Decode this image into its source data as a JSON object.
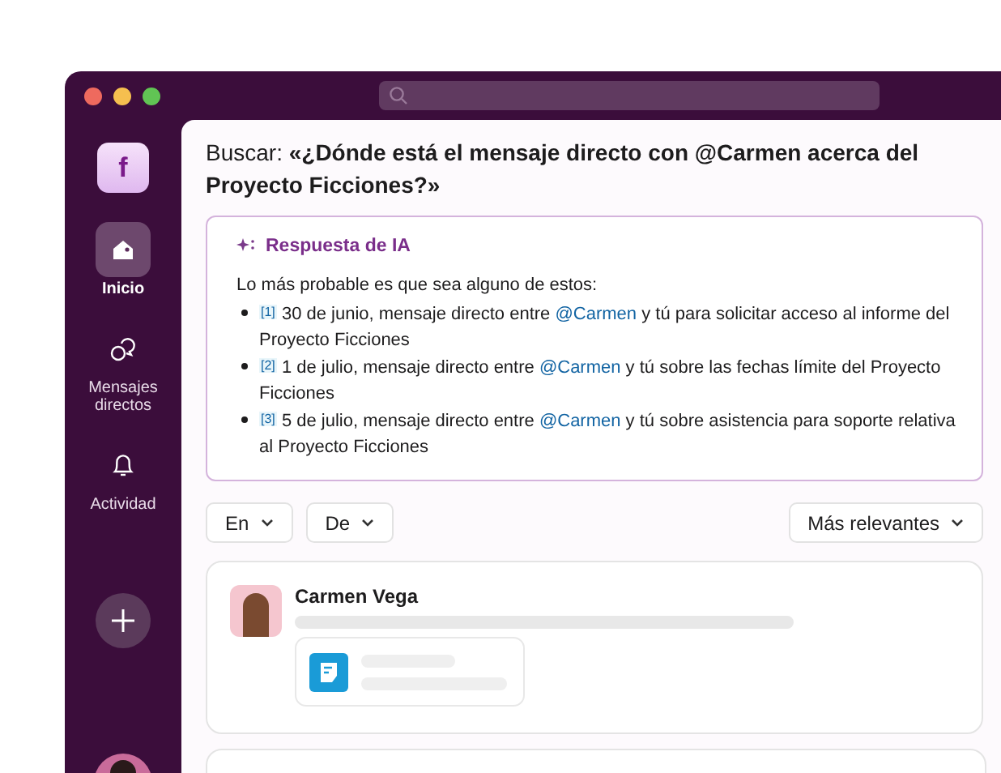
{
  "sidebar": {
    "workspace": "f",
    "items": [
      {
        "kind": "home",
        "label": "Inicio",
        "selected": true
      },
      {
        "kind": "dms",
        "label": "Mensajes directos",
        "selected": false
      },
      {
        "kind": "activity",
        "label": "Actividad",
        "selected": false
      }
    ]
  },
  "search": {
    "prefix": "Buscar:",
    "query": "«¿Dónde está el mensaje directo con @Carmen acerca del Proyecto Ficciones?»"
  },
  "ai_answer": {
    "title": "Respuesta de IA",
    "intro": "Lo más probable es que sea alguno de estos:",
    "items": [
      {
        "cite": "[1]",
        "before": "30 de junio, mensaje directo entre",
        "mention": "@Carmen",
        "after": "y tú para solicitar acceso al informe del Proyecto Ficciones"
      },
      {
        "cite": "[2]",
        "before": "1 de julio, mensaje directo entre",
        "mention": "@Carmen",
        "after": "y tú sobre las fechas límite del Proyecto Ficciones"
      },
      {
        "cite": "[3]",
        "before": "5 de julio, mensaje directo entre",
        "mention": "@Carmen",
        "after": "y tú sobre asistencia para soporte relativa al Proyecto Ficciones"
      }
    ]
  },
  "filters": [
    {
      "label": "En"
    },
    {
      "label": "De"
    }
  ],
  "sort": {
    "label": "Más relevantes"
  },
  "results": [
    {
      "author": "Carmen Vega"
    }
  ]
}
